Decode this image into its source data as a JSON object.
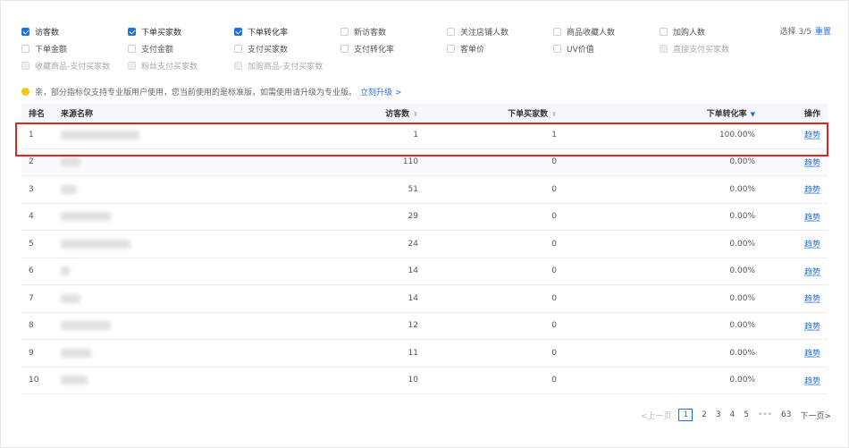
{
  "metrics": {
    "items": [
      {
        "label": "访客数",
        "state": "checked"
      },
      {
        "label": "下单买家数",
        "state": "checked"
      },
      {
        "label": "下单转化率",
        "state": "checked"
      },
      {
        "label": "新访客数",
        "state": "unchecked"
      },
      {
        "label": "关注店铺人数",
        "state": "unchecked"
      },
      {
        "label": "商品收藏人数",
        "state": "unchecked"
      },
      {
        "label": "加购人数",
        "state": "unchecked"
      },
      {
        "label": "下单金额",
        "state": "unchecked"
      },
      {
        "label": "支付金额",
        "state": "unchecked"
      },
      {
        "label": "支付买家数",
        "state": "unchecked"
      },
      {
        "label": "支付转化率",
        "state": "unchecked"
      },
      {
        "label": "客单价",
        "state": "unchecked"
      },
      {
        "label": "UV价值",
        "state": "unchecked"
      },
      {
        "label": "直接支付买家数",
        "state": "disabled"
      },
      {
        "label": "收藏商品-支付买家数",
        "state": "disabled"
      },
      {
        "label": "粉丝支付买家数",
        "state": "disabled"
      },
      {
        "label": "加购商品-支付买家数",
        "state": "disabled"
      }
    ],
    "selection_text": "选择 3/5",
    "reset_label": "重置"
  },
  "notice": {
    "text": "亲，部分指标仅支持专业版用户使用，您当前使用的是标准版，如需使用请升级为专业版。",
    "link": "立刻升级 >"
  },
  "table": {
    "headers": {
      "rank": "排名",
      "name": "来源名称",
      "visitors": "访客数",
      "buyers": "下单买家数",
      "rate": "下单转化率",
      "op": "操作"
    },
    "rows": [
      {
        "rank": "1",
        "visitors": "1",
        "buyers": "1",
        "rate": "100.00%",
        "op": "趋势"
      },
      {
        "rank": "2",
        "visitors": "110",
        "buyers": "0",
        "rate": "0.00%",
        "op": "趋势"
      },
      {
        "rank": "3",
        "visitors": "51",
        "buyers": "0",
        "rate": "0.00%",
        "op": "趋势"
      },
      {
        "rank": "4",
        "visitors": "29",
        "buyers": "0",
        "rate": "0.00%",
        "op": "趋势"
      },
      {
        "rank": "5",
        "visitors": "24",
        "buyers": "0",
        "rate": "0.00%",
        "op": "趋势"
      },
      {
        "rank": "6",
        "visitors": "14",
        "buyers": "0",
        "rate": "0.00%",
        "op": "趋势"
      },
      {
        "rank": "7",
        "visitors": "14",
        "buyers": "0",
        "rate": "0.00%",
        "op": "趋势"
      },
      {
        "rank": "8",
        "visitors": "12",
        "buyers": "0",
        "rate": "0.00%",
        "op": "趋势"
      },
      {
        "rank": "9",
        "visitors": "11",
        "buyers": "0",
        "rate": "0.00%",
        "op": "趋势"
      },
      {
        "rank": "10",
        "visitors": "10",
        "buyers": "0",
        "rate": "0.00%",
        "op": "趋势"
      }
    ]
  },
  "pagination": {
    "prev": "<上一页",
    "pages": [
      "1",
      "2",
      "3",
      "4",
      "5"
    ],
    "ellipsis": "•••",
    "last": "63",
    "next": "下一页>",
    "current": "1"
  }
}
